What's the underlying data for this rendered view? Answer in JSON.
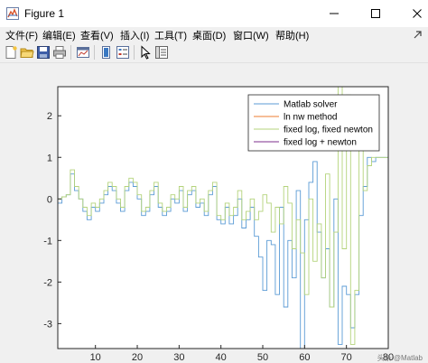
{
  "window": {
    "title": "Figure 1",
    "controls": {
      "minimize": "minimize",
      "maximize": "maximize",
      "close": "close"
    }
  },
  "menubar": {
    "items": [
      {
        "label": "文件(F)"
      },
      {
        "label": "编辑(E)"
      },
      {
        "label": "查看(V)"
      },
      {
        "label": "插入(I)"
      },
      {
        "label": "工具(T)"
      },
      {
        "label": "桌面(D)"
      },
      {
        "label": "窗口(W)"
      },
      {
        "label": "帮助(H)"
      }
    ],
    "dock_icon": "dock-arrow-icon"
  },
  "toolbar": {
    "buttons": [
      {
        "icon": "new-figure-icon"
      },
      {
        "icon": "open-file-icon"
      },
      {
        "icon": "save-icon"
      },
      {
        "icon": "print-icon"
      },
      {
        "icon": "link-plot-icon"
      },
      {
        "icon": "insert-colorbar-icon"
      },
      {
        "icon": "insert-legend-icon"
      },
      {
        "icon": "edit-plot-arrow-icon"
      },
      {
        "icon": "property-inspector-icon"
      }
    ]
  },
  "chart_data": {
    "type": "line",
    "title": "",
    "xlabel": "",
    "ylabel": "",
    "xlim": [
      1,
      80
    ],
    "ylim": [
      -3.6,
      2.7
    ],
    "xticks": [
      10,
      20,
      30,
      40,
      50,
      60,
      70,
      80
    ],
    "yticks": [
      2,
      1,
      0,
      -1,
      -2,
      -3
    ],
    "grid": false,
    "legend_position": "top-right",
    "series": [
      {
        "name": "Matlab solver",
        "color": "#5b9bd5",
        "x": [
          1,
          2,
          3,
          4,
          5,
          6,
          7,
          8,
          9,
          10,
          11,
          12,
          13,
          14,
          15,
          16,
          17,
          18,
          19,
          20,
          21,
          22,
          23,
          24,
          25,
          26,
          27,
          28,
          29,
          30,
          31,
          32,
          33,
          34,
          35,
          36,
          37,
          38,
          39,
          40,
          41,
          42,
          43,
          44,
          45,
          46,
          47,
          48,
          49,
          50,
          51,
          52,
          53,
          54,
          55,
          56,
          57,
          58,
          59,
          60,
          61,
          62,
          63,
          64,
          65,
          66,
          67,
          68,
          69,
          70,
          71,
          72,
          73,
          74,
          75,
          76,
          77,
          78,
          79,
          80
        ],
        "y": [
          -0.1,
          0.05,
          0.1,
          0.6,
          0.2,
          0.0,
          -0.3,
          -0.5,
          -0.2,
          -0.3,
          -0.1,
          0.1,
          0.3,
          0.2,
          -0.1,
          -0.3,
          0.2,
          0.4,
          0.3,
          0.0,
          -0.4,
          -0.3,
          0.1,
          0.3,
          -0.2,
          -0.4,
          -0.3,
          0.0,
          -0.1,
          0.2,
          -0.3,
          0.1,
          0.2,
          -0.2,
          -0.1,
          -0.4,
          0.1,
          0.3,
          -0.5,
          -0.6,
          -0.2,
          -0.6,
          -0.4,
          0.0,
          -0.7,
          -0.5,
          -0.2,
          -0.9,
          -1.4,
          -2.2,
          -1.0,
          -1.1,
          -2.3,
          -0.2,
          -2.6,
          -1.0,
          -1.9,
          0.2,
          -3.6,
          -0.5,
          0.4,
          0.9,
          -0.8,
          -1.9,
          -1.2,
          -2.6,
          0.0,
          -3.5,
          -2.1,
          -2.3,
          -3.1,
          -2.3,
          -0.4,
          0.3,
          1.0,
          0.9,
          1.0,
          1.0,
          1.0,
          1.0
        ]
      },
      {
        "name": "ln nw method",
        "color": "#ed7d31",
        "x": [],
        "y": []
      },
      {
        "name": "fixed log, fixed newton",
        "color": "#b4d37b",
        "x": [
          1,
          2,
          3,
          4,
          5,
          6,
          7,
          8,
          9,
          10,
          11,
          12,
          13,
          14,
          15,
          16,
          17,
          18,
          19,
          20,
          21,
          22,
          23,
          24,
          25,
          26,
          27,
          28,
          29,
          30,
          31,
          32,
          33,
          34,
          35,
          36,
          37,
          38,
          39,
          40,
          41,
          42,
          43,
          44,
          45,
          46,
          47,
          48,
          49,
          50,
          51,
          52,
          53,
          54,
          55,
          56,
          57,
          58,
          59,
          60,
          61,
          62,
          63,
          64,
          65,
          66,
          67,
          68,
          69,
          70,
          71,
          72,
          73,
          74,
          75,
          76,
          77,
          78,
          79,
          80
        ],
        "y": [
          0.0,
          0.05,
          0.1,
          0.7,
          0.3,
          0.0,
          -0.2,
          -0.4,
          -0.1,
          -0.2,
          0.0,
          0.2,
          0.4,
          0.3,
          0.0,
          -0.2,
          0.3,
          0.5,
          0.4,
          0.1,
          -0.3,
          -0.2,
          0.2,
          0.4,
          -0.1,
          -0.3,
          -0.2,
          0.1,
          0.0,
          0.3,
          -0.2,
          0.2,
          0.3,
          -0.1,
          0.0,
          -0.3,
          0.2,
          0.4,
          -0.4,
          -0.5,
          -0.1,
          -0.4,
          -0.2,
          0.2,
          -0.5,
          -0.3,
          0.0,
          -0.5,
          -0.3,
          0.1,
          -0.1,
          -0.8,
          -0.2,
          -0.6,
          0.3,
          -0.1,
          -1.2,
          -0.5,
          -1.3,
          -2.3,
          0.0,
          -1.5,
          -0.6,
          -1.9,
          0.6,
          -2.6,
          -0.8,
          2.8,
          -1.2,
          2.5,
          -3.5,
          -2.2,
          1.2,
          0.2,
          0.8,
          1.0,
          1.0,
          1.0,
          1.0,
          1.0
        ]
      },
      {
        "name": "fixed log + newton",
        "color": "#7e2f8e",
        "x": [],
        "y": []
      }
    ]
  },
  "watermark": "头条 @Matlab"
}
